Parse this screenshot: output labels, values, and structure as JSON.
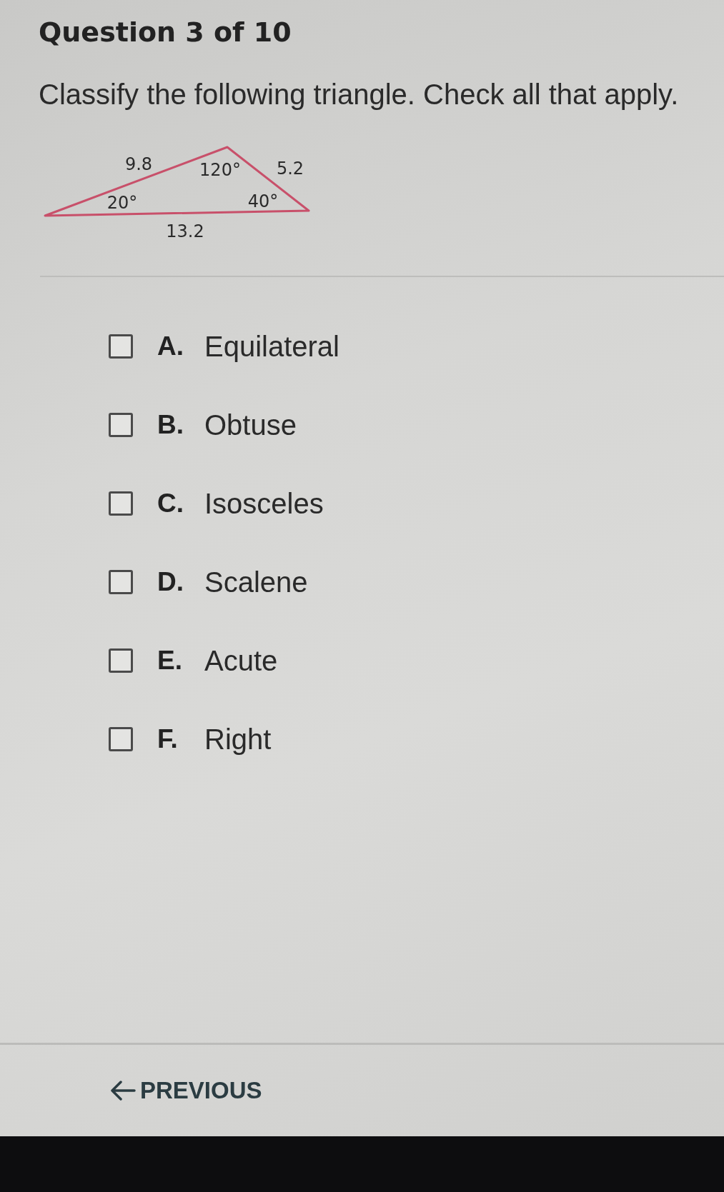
{
  "question": {
    "header": "Question 3 of 10",
    "prompt": "Classify the following triangle. Check all that apply."
  },
  "triangle": {
    "side_labels": [
      "9.8",
      "5.2",
      "13.2"
    ],
    "angle_labels": [
      "120°",
      "20°",
      "40°"
    ]
  },
  "options": [
    {
      "letter": "A.",
      "text": "Equilateral",
      "checked": false
    },
    {
      "letter": "B.",
      "text": "Obtuse",
      "checked": false
    },
    {
      "letter": "C.",
      "text": "Isosceles",
      "checked": false
    },
    {
      "letter": "D.",
      "text": "Scalene",
      "checked": false
    },
    {
      "letter": "E.",
      "text": "Acute",
      "checked": false
    },
    {
      "letter": "F.",
      "text": "Right",
      "checked": false
    }
  ],
  "navigation": {
    "previous_label": "PREVIOUS"
  }
}
